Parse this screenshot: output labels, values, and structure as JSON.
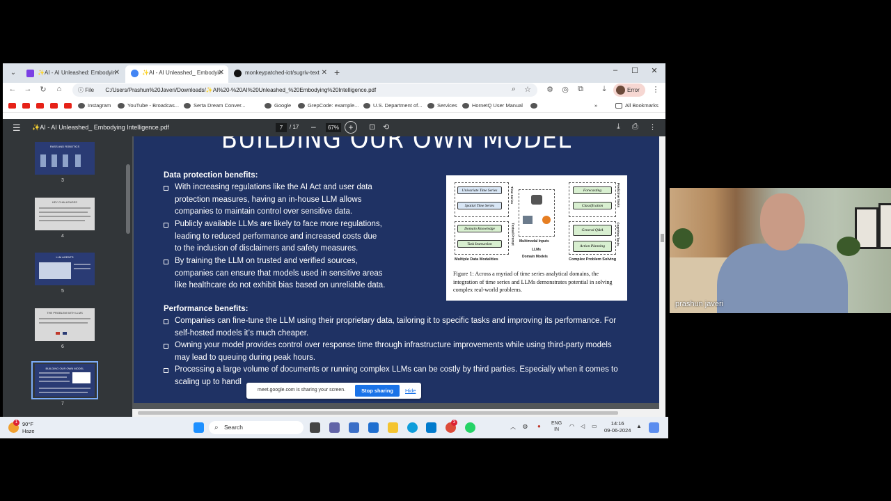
{
  "tabs": [
    {
      "label": "✨AI - AI Unleashed: Embodyin",
      "color": "#7b3fe4"
    },
    {
      "label": "✨AI - AI Unleashed_ Embodyin",
      "color": "#4285f4"
    },
    {
      "label": "monkeypatched-iot/sugriv-text",
      "color": "#111111"
    }
  ],
  "toolbar": {
    "file_label": "File",
    "url": "C:/Users/Prashun%20Javeri/Downloads/✨AI%20-%20AI%20Unleashed_%20Embodying%20Intelligence.pdf",
    "error_label": "Error"
  },
  "bookmarks": {
    "items": [
      "Instagram",
      "YouTube - Broadcas...",
      "Serta Dream Conver...",
      "Google",
      "GrepCode: example...",
      "U.S. Department of...",
      "Services",
      "HornetQ User Manual"
    ],
    "all_label": "All Bookmarks"
  },
  "pdf": {
    "title": "✨AI - AI Unleashed_ Embodying Intelligence.pdf",
    "page_current": "7",
    "page_total": "/ 17",
    "zoom": "67%"
  },
  "thumbnails": [
    {
      "num": "3",
      "title": "RASS AND ROBOTICS"
    },
    {
      "num": "4",
      "title": "KEY CHALLENGES"
    },
    {
      "num": "5",
      "title": "LLM AGENTS"
    },
    {
      "num": "6",
      "title": "THE PROBLEM WITH LLMS"
    },
    {
      "num": "7",
      "title": "BUILDING OUR OWN MODEL"
    }
  ],
  "slide": {
    "title": "BUILDING OUR OWN MODEL",
    "data_heading": "Data protection benefits:",
    "data_bullets": [
      [
        "With increasing regulations like the AI Act and user data",
        "protection measures, having an in-house LLM allows",
        "companies to maintain control over sensitive data."
      ],
      [
        "Publicly available LLMs are likely to face more regulations,",
        "leading to reduced performance and increased costs due",
        "to the inclusion of disclaimers and safety measures."
      ],
      [
        "By training the LLM on trusted and verified sources,",
        "companies can ensure that models used in sensitive areas",
        "like healthcare do not exhibit bias based on unreliable data."
      ]
    ],
    "perf_heading": "Performance benefits:",
    "perf_bullets": [
      [
        "Companies can fine-tune the LLM using their proprietary data, tailoring it to specific tasks and improving its performance. For",
        "self-hosted models it’s much cheaper."
      ],
      [
        "Owning your model provides control over response time through infrastructure improvements while using third-party models",
        "may lead to queuing during peak hours."
      ],
      [
        "Processing a large volume of documents or running complex LLMs can be costly by third parties. Especially when it comes to",
        "scaling up to handl"
      ]
    ],
    "figure": {
      "left_pills": [
        "Univariate Time Series",
        "Spatial Time Series",
        "Domain Knowledge",
        "Task Instruction"
      ],
      "left_side_labels": [
        "Time Series",
        "Textual Prompt"
      ],
      "right_pills": [
        "Forecasting",
        "Classification",
        "General Q&A",
        "Action Planning"
      ],
      "right_side_labels": [
        "Predictive Tasks",
        "Cognitive Tasks"
      ],
      "center_labels": [
        "Multimodal Inputs",
        "LLMs",
        "Domain Models"
      ],
      "bottom_labels": [
        "Multiple Data Modalities",
        "Complex Problem Solving"
      ],
      "caption": "Figure 1: Across a myriad of time series analytical domains, the integration of time series and LLMs demonstrates potential in solving complex real-world problems."
    }
  },
  "share": {
    "message": "meet.google.com is sharing your screen.",
    "stop_label": "Stop sharing",
    "hide_label": "Hide"
  },
  "taskbar": {
    "temp": "90°F",
    "weather": "Haze",
    "search_label": "Search",
    "lang1": "ENG",
    "lang2": "IN",
    "time": "14:16",
    "date": "09-06-2024",
    "badge": "1",
    "chrome_badge": "3"
  },
  "camera": {
    "participant": "prashun javeri"
  }
}
